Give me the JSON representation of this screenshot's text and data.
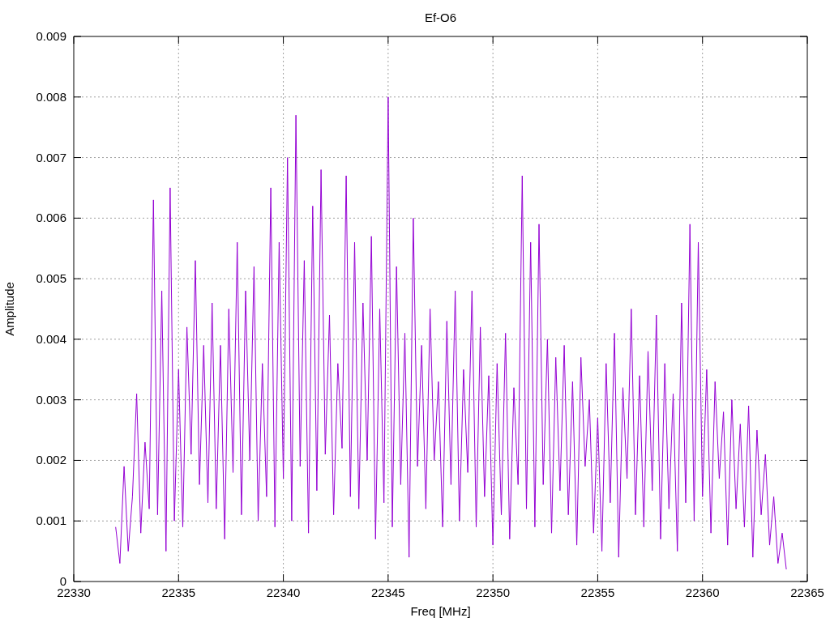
{
  "chart": {
    "chart_data": {
      "type": "line",
      "title": "Ef-O6",
      "xlabel": "Freq [MHz]",
      "ylabel": "Amplitude",
      "grid": true,
      "xlim": [
        22330,
        22365
      ],
      "ylim": [
        0,
        0.009
      ],
      "xticks": [
        22330,
        22335,
        22340,
        22345,
        22350,
        22355,
        22360,
        22365
      ],
      "yticks": [
        {
          "value": 0,
          "label": "0"
        },
        {
          "value": 0.001,
          "label": "0.001"
        },
        {
          "value": 0.002,
          "label": "0.002"
        },
        {
          "value": 0.003,
          "label": "0.003"
        },
        {
          "value": 0.004,
          "label": "0.004"
        },
        {
          "value": 0.005,
          "label": "0.005"
        },
        {
          "value": 0.006,
          "label": "0.006"
        },
        {
          "value": 0.007,
          "label": "0.007"
        },
        {
          "value": 0.008,
          "label": "0.008"
        },
        {
          "value": 0.009,
          "label": "0.009"
        }
      ],
      "x": [
        22332,
        22332.2,
        22332.4,
        22332.6,
        22332.8,
        22333,
        22333.2,
        22333.4,
        22333.6,
        22333.8,
        22334,
        22334.2,
        22334.4,
        22334.6,
        22334.8,
        22335,
        22335.2,
        22335.4,
        22335.6,
        22335.8,
        22336,
        22336.2,
        22336.4,
        22336.6,
        22336.8,
        22337,
        22337.2,
        22337.4,
        22337.6,
        22337.8,
        22338,
        22338.2,
        22338.4,
        22338.6,
        22338.8,
        22339,
        22339.2,
        22339.4,
        22339.6,
        22339.8,
        22340,
        22340.2,
        22340.4,
        22340.6,
        22340.8,
        22341,
        22341.2,
        22341.4,
        22341.6,
        22341.8,
        22342,
        22342.2,
        22342.4,
        22342.6,
        22342.8,
        22343,
        22343.2,
        22343.4,
        22343.6,
        22343.8,
        22344,
        22344.2,
        22344.4,
        22344.6,
        22344.8,
        22345,
        22345.2,
        22345.4,
        22345.6,
        22345.8,
        22346,
        22346.2,
        22346.4,
        22346.6,
        22346.8,
        22347,
        22347.2,
        22347.4,
        22347.6,
        22347.8,
        22348,
        22348.2,
        22348.4,
        22348.6,
        22348.8,
        22349,
        22349.2,
        22349.4,
        22349.6,
        22349.8,
        22350,
        22350.2,
        22350.4,
        22350.6,
        22350.8,
        22351,
        22351.2,
        22351.4,
        22351.6,
        22351.8,
        22352,
        22352.2,
        22352.4,
        22352.6,
        22352.8,
        22353,
        22353.2,
        22353.4,
        22353.6,
        22353.8,
        22354,
        22354.2,
        22354.4,
        22354.6,
        22354.8,
        22355,
        22355.2,
        22355.4,
        22355.6,
        22355.8,
        22356,
        22356.2,
        22356.4,
        22356.6,
        22356.8,
        22357,
        22357.2,
        22357.4,
        22357.6,
        22357.8,
        22358,
        22358.2,
        22358.4,
        22358.6,
        22358.8,
        22359,
        22359.2,
        22359.4,
        22359.6,
        22359.8,
        22360,
        22360.2,
        22360.4,
        22360.6,
        22360.8,
        22361,
        22361.2,
        22361.4,
        22361.6,
        22361.8,
        22362,
        22362.2,
        22362.4,
        22362.6,
        22362.8,
        22363,
        22363.2,
        22363.4,
        22363.6,
        22363.8,
        22364
      ],
      "series": [
        {
          "color": "#9400d3",
          "values": [
            0.0009,
            0.0003,
            0.0019,
            0.0005,
            0.0014,
            0.0031,
            0.0008,
            0.0023,
            0.0012,
            0.0063,
            0.0011,
            0.0048,
            0.0005,
            0.0065,
            0.001,
            0.0035,
            0.0009,
            0.0042,
            0.0021,
            0.0053,
            0.0016,
            0.0039,
            0.0013,
            0.0046,
            0.0012,
            0.0039,
            0.0007,
            0.0045,
            0.0018,
            0.0056,
            0.0011,
            0.0048,
            0.002,
            0.0052,
            0.001,
            0.0036,
            0.0014,
            0.0065,
            0.0009,
            0.0056,
            0.0017,
            0.007,
            0.001,
            0.0077,
            0.0019,
            0.0053,
            0.0008,
            0.0062,
            0.0015,
            0.0068,
            0.0021,
            0.0044,
            0.0011,
            0.0036,
            0.0022,
            0.0067,
            0.0014,
            0.0056,
            0.0012,
            0.0046,
            0.002,
            0.0057,
            0.0007,
            0.0045,
            0.0013,
            0.008,
            0.0009,
            0.0052,
            0.0016,
            0.0041,
            0.0004,
            0.006,
            0.0019,
            0.0039,
            0.0012,
            0.0045,
            0.002,
            0.0033,
            0.0009,
            0.0043,
            0.0016,
            0.0048,
            0.001,
            0.0035,
            0.0018,
            0.0048,
            0.0009,
            0.0042,
            0.0014,
            0.0034,
            0.0006,
            0.0036,
            0.0011,
            0.0041,
            0.0007,
            0.0032,
            0.0016,
            0.0067,
            0.0012,
            0.0056,
            0.0009,
            0.0059,
            0.0016,
            0.004,
            0.0008,
            0.0037,
            0.0015,
            0.0039,
            0.0011,
            0.0033,
            0.0006,
            0.0037,
            0.0019,
            0.003,
            0.0008,
            0.0027,
            0.0005,
            0.0036,
            0.0013,
            0.0041,
            0.0004,
            0.0032,
            0.0017,
            0.0045,
            0.0011,
            0.0034,
            0.0009,
            0.0038,
            0.0015,
            0.0044,
            0.0007,
            0.0036,
            0.0012,
            0.0031,
            0.0005,
            0.0046,
            0.0013,
            0.0059,
            0.001,
            0.0056,
            0.0014,
            0.0035,
            0.0008,
            0.0033,
            0.0017,
            0.0028,
            0.0006,
            0.003,
            0.0012,
            0.0026,
            0.0009,
            0.0029,
            0.0004,
            0.0025,
            0.0011,
            0.0021,
            0.0006,
            0.0014,
            0.0003,
            0.0008,
            0.0002
          ]
        }
      ]
    }
  }
}
